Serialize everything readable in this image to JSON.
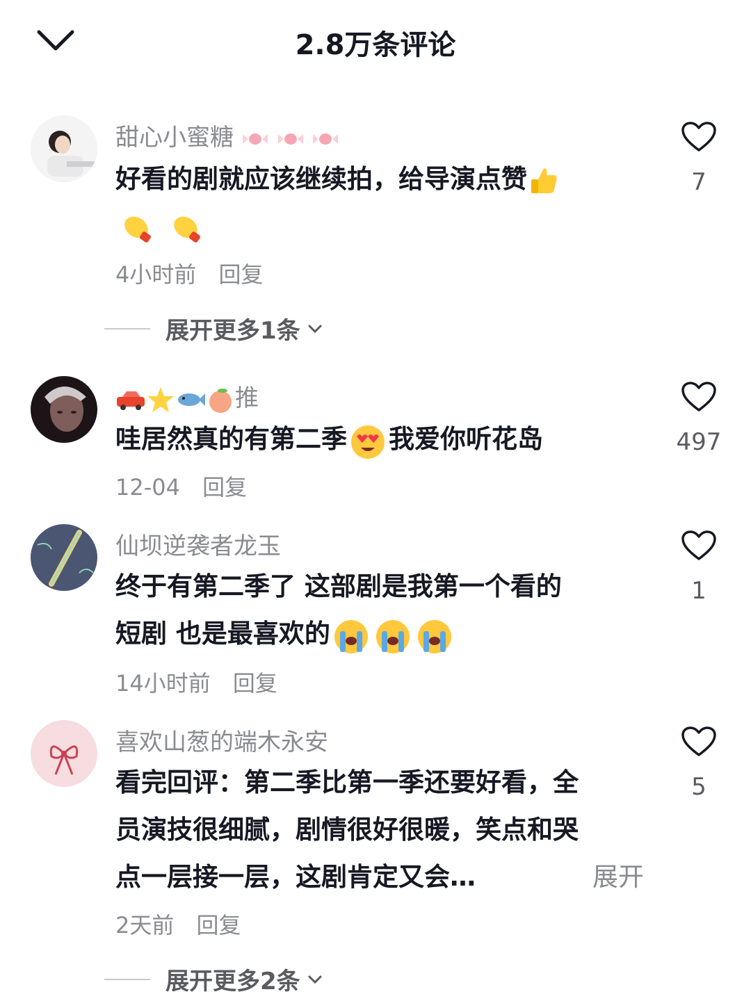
{
  "header": {
    "title": "2.8万条评论"
  },
  "comments": [
    {
      "username": "甜心小蜜糖",
      "text_line1": "好看的剧就应该继续拍，给导演点赞",
      "time": "4小时前",
      "reply": "回复",
      "likes": "7",
      "expand_more": "展开更多1条"
    },
    {
      "username": "推",
      "text_part1": "哇居然真的有第二季",
      "text_part2": "我爱你听花岛",
      "time": "12-04",
      "reply": "回复",
      "likes": "497"
    },
    {
      "username": "仙坝逆袭者龙玉",
      "text_line1": "终于有第二季了 这部剧是我第一个看的",
      "text_line2": "短剧 也是最喜欢的",
      "time": "14小时前",
      "reply": "回复",
      "likes": "1"
    },
    {
      "username": "喜欢山葱的端木永安",
      "text_line1": "看完回评：第二季比第一季还要好看，全",
      "text_line2": "员演技很细腻，剧情很好很暖，笑点和哭",
      "text_line3": "点一层接一层，这剧肯定又会…",
      "expand": "展开",
      "time": "2天前",
      "reply": "回复",
      "likes": "5",
      "expand_more": "展开更多2条"
    }
  ],
  "colors": {
    "secondary_text": "#8a8b91",
    "primary_text": "#161823"
  }
}
